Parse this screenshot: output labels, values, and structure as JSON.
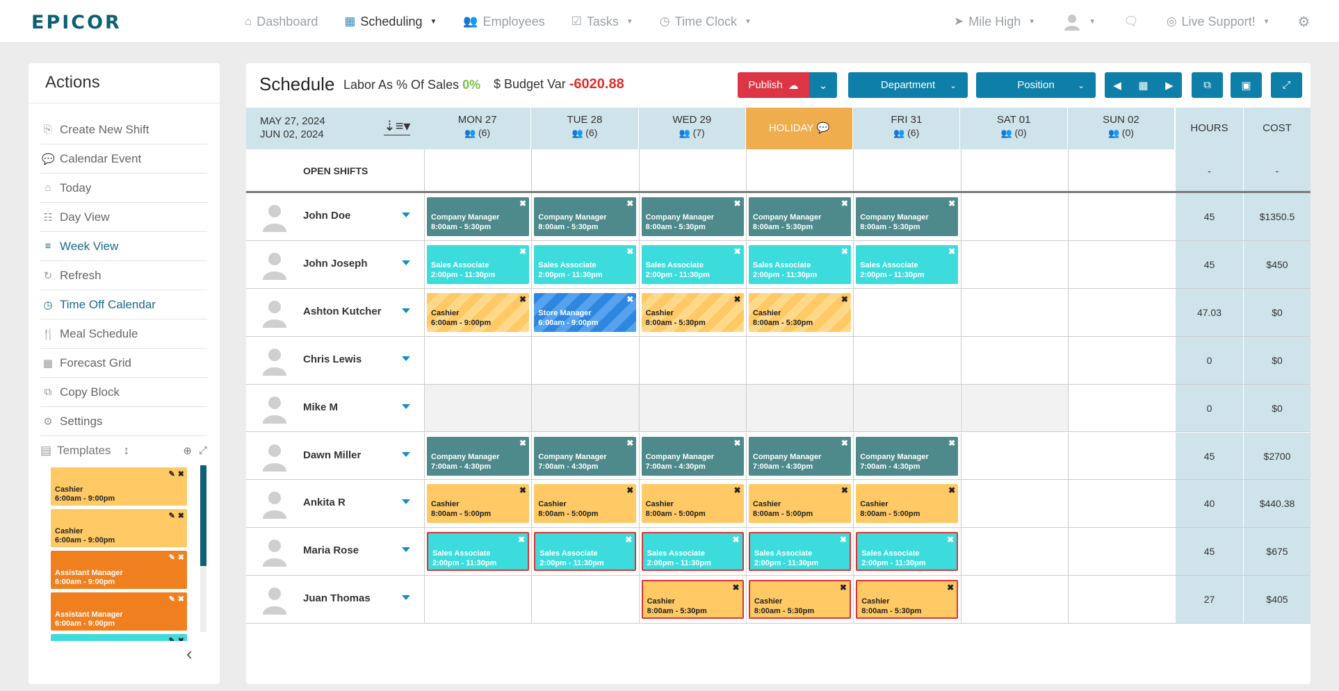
{
  "app": {
    "logo": "EPICOR"
  },
  "nav": {
    "dashboard": "Dashboard",
    "scheduling": "Scheduling",
    "employees": "Employees",
    "tasks": "Tasks",
    "time_clock": "Time Clock",
    "location": "Mile High",
    "live_support": "Live Support!"
  },
  "actions": {
    "title": "Actions",
    "items": [
      {
        "label": "Create New Shift",
        "icon": "copy-icon"
      },
      {
        "label": "Calendar Event",
        "icon": "comment-icon"
      },
      {
        "label": "Today",
        "icon": "home-icon"
      },
      {
        "label": "Day View",
        "icon": "list-icon"
      },
      {
        "label": "Week View",
        "icon": "bars-icon"
      },
      {
        "label": "Refresh",
        "icon": "refresh-icon"
      },
      {
        "label": "Time Off Calendar",
        "icon": "clock-icon"
      },
      {
        "label": "Meal Schedule",
        "icon": "utensils-icon"
      },
      {
        "label": "Forecast Grid",
        "icon": "grid-icon"
      },
      {
        "label": "Copy Block",
        "icon": "copy-block-icon"
      },
      {
        "label": "Settings",
        "icon": "gears-icon"
      }
    ],
    "templates_label": "Templates",
    "templates": [
      {
        "role": "Cashier",
        "time": "6:00am - 9:00pm",
        "color": "yellow"
      },
      {
        "role": "Cashier",
        "time": "6:00am - 9:00pm",
        "color": "yellow"
      },
      {
        "role": "Assistant Manager",
        "time": "6:00am - 9:00pm",
        "color": "orange"
      },
      {
        "role": "Assistant Manager",
        "time": "6:00am - 9:00pm",
        "color": "orange"
      },
      {
        "role": "",
        "time": "",
        "color": "cyan"
      }
    ]
  },
  "schedule": {
    "title": "Schedule",
    "labor_label": "Labor As % Of Sales",
    "labor_value": "0%",
    "budget_label": "$ Budget Var",
    "budget_value": "-6020.88",
    "publish_label": "Publish",
    "department_label": "Department",
    "position_label": "Position",
    "range_start": "MAY 27, 2024",
    "range_end": "JUN 02, 2024",
    "days": [
      {
        "label": "MON 27",
        "count": "(6)",
        "holiday": false
      },
      {
        "label": "TUE 28",
        "count": "(6)",
        "holiday": false
      },
      {
        "label": "WED 29",
        "count": "(7)",
        "holiday": false
      },
      {
        "label": "HOLIDAY",
        "count": "",
        "holiday": true
      },
      {
        "label": "FRI 31",
        "count": "(6)",
        "holiday": false
      },
      {
        "label": "SAT 01",
        "count": "(0)",
        "holiday": false
      },
      {
        "label": "SUN 02",
        "count": "(0)",
        "holiday": false
      }
    ],
    "hours_label": "HOURS",
    "cost_label": "COST",
    "open_shifts_label": "OPEN SHIFTS",
    "open_hours": "-",
    "open_cost": "-",
    "employees": [
      {
        "name": "John Doe",
        "hours": "45",
        "cost": "$1350.5",
        "grey": false,
        "shifts": [
          {
            "day": 0,
            "role": "Company Manager",
            "time": "8:00am - 5:30pm",
            "style": "teal"
          },
          {
            "day": 1,
            "role": "Company Manager",
            "time": "8:00am - 5:30pm",
            "style": "teal"
          },
          {
            "day": 2,
            "role": "Company Manager",
            "time": "8:00am - 5:30pm",
            "style": "teal"
          },
          {
            "day": 3,
            "role": "Company Manager",
            "time": "8:00am - 5:30pm",
            "style": "teal"
          },
          {
            "day": 4,
            "role": "Company Manager",
            "time": "8:00am - 5:30pm",
            "style": "teal"
          }
        ]
      },
      {
        "name": "John Joseph",
        "hours": "45",
        "cost": "$450",
        "grey": false,
        "shifts": [
          {
            "day": 0,
            "role": "Sales Associate",
            "time": "2:00pm - 11:30pm",
            "style": "cyan"
          },
          {
            "day": 1,
            "role": "Sales Associate",
            "time": "2:00pm - 11:30pm",
            "style": "cyan"
          },
          {
            "day": 2,
            "role": "Sales Associate",
            "time": "2:00pm - 11:30pm",
            "style": "cyan"
          },
          {
            "day": 3,
            "role": "Sales Associate",
            "time": "2:00pm - 11:30pm",
            "style": "cyan"
          },
          {
            "day": 4,
            "role": "Sales Associate",
            "time": "2:00pm - 11:30pm",
            "style": "cyan"
          }
        ]
      },
      {
        "name": "Ashton Kutcher",
        "hours": "47.03",
        "cost": "$0",
        "grey": false,
        "shifts": [
          {
            "day": 0,
            "role": "Cashier",
            "time": "6:00am - 9:00pm",
            "style": "striped"
          },
          {
            "day": 1,
            "role": "Store Manager",
            "time": "6:00am - 9:00pm",
            "style": "bluestripe"
          },
          {
            "day": 2,
            "role": "Cashier",
            "time": "8:00am - 5:30pm",
            "style": "striped"
          },
          {
            "day": 3,
            "role": "Cashier",
            "time": "8:00am - 5:30pm",
            "style": "striped"
          }
        ]
      },
      {
        "name": "Chris Lewis",
        "hours": "0",
        "cost": "$0",
        "grey": false,
        "shifts": []
      },
      {
        "name": "Mike M",
        "hours": "0",
        "cost": "$0",
        "grey": true,
        "shifts": []
      },
      {
        "name": "Dawn Miller",
        "hours": "45",
        "cost": "$2700",
        "grey": false,
        "shifts": [
          {
            "day": 0,
            "role": "Company Manager",
            "time": "7:00am - 4:30pm",
            "style": "teal"
          },
          {
            "day": 1,
            "role": "Company Manager",
            "time": "7:00am - 4:30pm",
            "style": "teal"
          },
          {
            "day": 2,
            "role": "Company Manager",
            "time": "7:00am - 4:30pm",
            "style": "teal"
          },
          {
            "day": 3,
            "role": "Company Manager",
            "time": "7:00am - 4:30pm",
            "style": "teal"
          },
          {
            "day": 4,
            "role": "Company Manager",
            "time": "7:00am - 4:30pm",
            "style": "teal"
          }
        ]
      },
      {
        "name": "Ankita R",
        "hours": "40",
        "cost": "$440.38",
        "grey": false,
        "shifts": [
          {
            "day": 0,
            "role": "Cashier",
            "time": "8:00am - 5:00pm",
            "style": "yellow"
          },
          {
            "day": 1,
            "role": "Cashier",
            "time": "8:00am - 5:00pm",
            "style": "yellow"
          },
          {
            "day": 2,
            "role": "Cashier",
            "time": "8:00am - 5:00pm",
            "style": "yellow"
          },
          {
            "day": 3,
            "role": "Cashier",
            "time": "8:00am - 5:00pm",
            "style": "yellow"
          },
          {
            "day": 4,
            "role": "Cashier",
            "time": "8:00am - 5:00pm",
            "style": "yellow"
          }
        ]
      },
      {
        "name": "Maria Rose",
        "hours": "45",
        "cost": "$675",
        "grey": false,
        "shifts": [
          {
            "day": 0,
            "role": "Sales Associate",
            "time": "2:00pm - 11:30pm",
            "style": "cyan redb"
          },
          {
            "day": 1,
            "role": "Sales Associate",
            "time": "2:00pm - 11:30pm",
            "style": "cyan redb"
          },
          {
            "day": 2,
            "role": "Sales Associate",
            "time": "2:00pm - 11:30pm",
            "style": "cyan redb"
          },
          {
            "day": 3,
            "role": "Sales Associate",
            "time": "2:00pm - 11:30pm",
            "style": "cyan redb"
          },
          {
            "day": 4,
            "role": "Sales Associate",
            "time": "2:00pm - 11:30pm",
            "style": "cyan redb"
          }
        ]
      },
      {
        "name": "Juan Thomas",
        "hours": "27",
        "cost": "$405",
        "grey": false,
        "shifts": [
          {
            "day": 2,
            "role": "Cashier",
            "time": "8:00am - 5:30pm",
            "style": "yellow redb"
          },
          {
            "day": 3,
            "role": "Cashier",
            "time": "8:00am - 5:30pm",
            "style": "yellow redb"
          },
          {
            "day": 4,
            "role": "Cashier",
            "time": "8:00am - 5:30pm",
            "style": "yellow redb"
          }
        ]
      }
    ]
  }
}
